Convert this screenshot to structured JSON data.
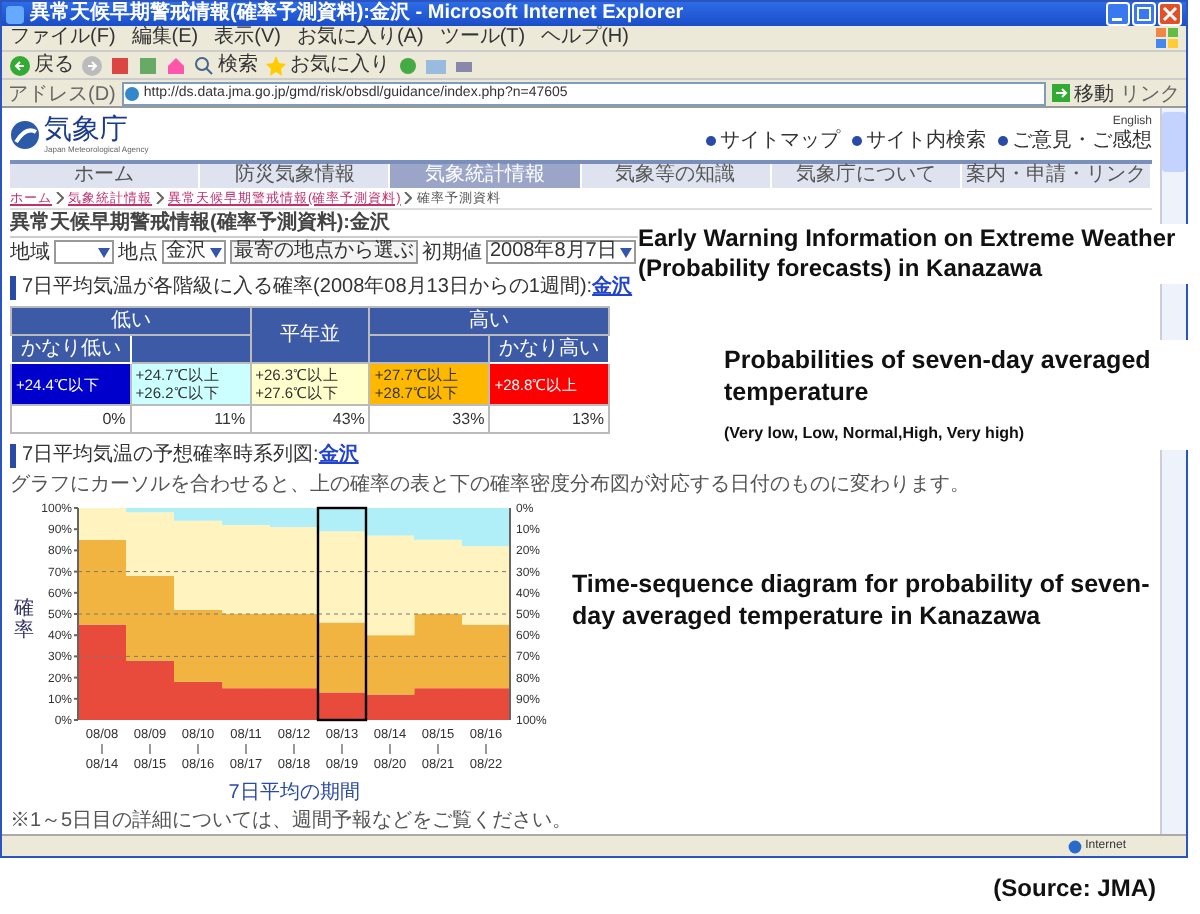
{
  "window": {
    "title": "異常天候早期警戒情報(確率予測資料):金沢 - Microsoft Internet Explorer"
  },
  "menu": [
    "ファイル(F)",
    "編集(E)",
    "表示(V)",
    "お気に入り(A)",
    "ツール(T)",
    "ヘルプ(H)"
  ],
  "toolbar": {
    "back": "戻る",
    "search": "検索",
    "favorites": "お気に入り"
  },
  "address_bar": {
    "label": "アドレス(D)",
    "value": "http://ds.data.jma.go.jp/gmd/risk/obsdl/guidance/index.php?n=47605",
    "go": "移動",
    "links": "リンク"
  },
  "site": {
    "logo": "気象庁",
    "logo_subtitle": "Japan Meteorological Agency",
    "english_link": "English",
    "top_links": [
      "サイトマップ",
      "サイト内検索",
      "ご意見・ご感想"
    ],
    "nav": [
      {
        "label": "ホーム",
        "selected": false
      },
      {
        "label": "防災気象情報",
        "selected": false
      },
      {
        "label": "気象統計情報",
        "selected": true
      },
      {
        "label": "気象等の知識",
        "selected": false
      },
      {
        "label": "気象庁について",
        "selected": false
      },
      {
        "label": "案内・申請・リンク",
        "selected": false
      }
    ],
    "breadcrumb": [
      {
        "label": "ホーム",
        "link": true
      },
      {
        "label": "気象統計情報",
        "link": true
      },
      {
        "label": "異常天候早期警戒情報(確率予測資料)",
        "link": true
      },
      {
        "label": "確率予測資料",
        "link": false
      }
    ]
  },
  "page_title": "異常天候早期警戒情報(確率予測資料):金沢",
  "form": {
    "region_label": "地域",
    "point_label": "地点",
    "point_value": "金沢",
    "nearest_button": "最寄の地点から選ぶ",
    "init_label": "初期値",
    "init_value": "2008年8月7日"
  },
  "probability_section": {
    "heading": "7日平均気温が各階級に入る確率(2008年08月13日からの1週間):",
    "place_link": "金沢",
    "groups": [
      {
        "label": "低い",
        "columns": [
          {
            "sub_label": "かなり低い",
            "range": "+24.4℃以下",
            "probability": "0%",
            "color": "#0000cc"
          },
          {
            "range": "+24.7℃以上+26.2℃以下",
            "probability": "11%",
            "color": "#ccffff"
          }
        ]
      },
      {
        "label": "平年並",
        "columns": [
          {
            "range": "+26.3℃以上+27.6℃以下",
            "probability": "43%",
            "color": "#ffffcc"
          }
        ]
      },
      {
        "label": "高い",
        "columns": [
          {
            "range": "+27.7℃以上+28.7℃以下",
            "probability": "33%",
            "color": "#ffb800"
          },
          {
            "sub_label": "かなり高い",
            "range": "+28.8℃以上",
            "probability": "13%",
            "color": "#ff0000"
          }
        ]
      }
    ]
  },
  "timeseries_section": {
    "heading": "7日平均気温の予想確率時系列図:",
    "place_link": "金沢",
    "description": "グラフにカーソルを合わせると、上の確率の表と下の確率密度分布図が対応する日付のものに変わります。",
    "right_axis_labels": [
      "0%",
      "10%",
      "20%",
      "30%",
      "40%",
      "50%",
      "60%",
      "70%",
      "80%",
      "90%",
      "100%"
    ],
    "periods": [
      {
        "end": "08/14",
        "selected": false
      },
      {
        "end": "08/15",
        "selected": false
      },
      {
        "end": "08/16",
        "selected": false
      },
      {
        "end": "08/17",
        "selected": false
      },
      {
        "end": "08/18",
        "selected": false
      },
      {
        "end": "08/19",
        "selected": true
      },
      {
        "end": "08/20",
        "selected": false
      },
      {
        "end": "08/21",
        "selected": false
      },
      {
        "end": "08/22",
        "selected": false
      }
    ],
    "chart_data": {
      "type": "bar",
      "stacked": true,
      "ylabel": "確率",
      "xlabel": "7日平均の期間",
      "categories": [
        "08/08",
        "08/09",
        "08/10",
        "08/11",
        "08/12",
        "08/13",
        "08/14",
        "08/15",
        "08/16"
      ],
      "ylim": [
        0,
        100
      ],
      "grid": true,
      "yticks": [
        {
          "value": 0,
          "label": "0%"
        },
        {
          "value": 10,
          "label": "10%"
        },
        {
          "value": 20,
          "label": "20%"
        },
        {
          "value": 30,
          "label": "30%"
        },
        {
          "value": 40,
          "label": "40%"
        },
        {
          "value": 50,
          "label": "50%"
        },
        {
          "value": 60,
          "label": "60%"
        },
        {
          "value": 70,
          "label": "70%"
        },
        {
          "value": 80,
          "label": "80%"
        },
        {
          "value": 90,
          "label": "90%"
        },
        {
          "value": 100,
          "label": "100%"
        }
      ],
      "series": [
        {
          "color": "#e84a3c",
          "values": [
            45,
            28,
            18,
            15,
            15,
            13,
            12,
            15,
            15
          ]
        },
        {
          "color": "#f2b440",
          "values": [
            40,
            40,
            34,
            35,
            35,
            33,
            28,
            35,
            30
          ]
        },
        {
          "color": "#fff3bf",
          "values": [
            15,
            30,
            42,
            42,
            41,
            43,
            47,
            35,
            37
          ]
        },
        {
          "color": "#b0eef8",
          "values": [
            0,
            2,
            6,
            8,
            9,
            11,
            13,
            15,
            18
          ]
        }
      ]
    }
  },
  "footnote": "※1～5日目の詳細については、週間予報などをご覧ください。",
  "status_bar": {
    "zone": "Internet"
  },
  "overlays": [
    {
      "kind": "title",
      "text": "Early Warning Information on Extreme Weather (Probability forecasts) in Kanazawa"
    },
    {
      "kind": "table-note",
      "text": "Probabilities of seven-day averaged temperature",
      "note": "(Very low, Low, Normal,High, Very high)"
    },
    {
      "kind": "chart-note",
      "text": "Time-sequence diagram for probability of seven-day averaged temperature in Kanazawa"
    }
  ],
  "source": "(Source: JMA)"
}
